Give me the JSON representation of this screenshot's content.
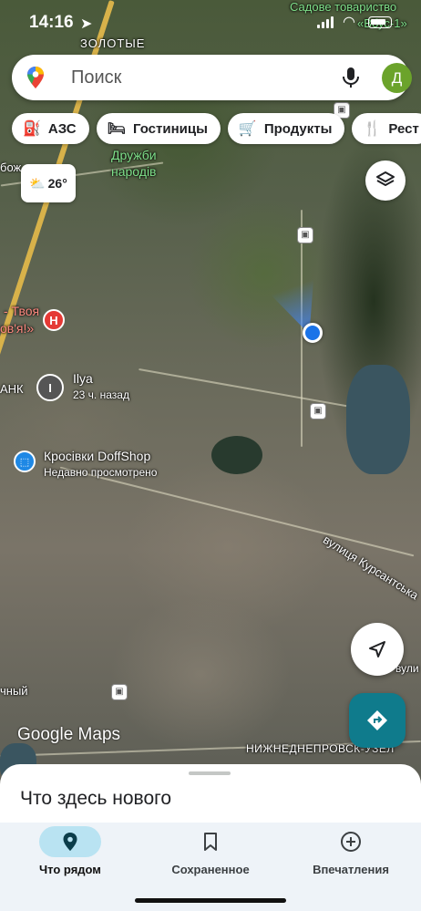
{
  "status_bar": {
    "time": "14:16",
    "carrier_label": "Садове товариство",
    "carrier_label_2": "«Вбус-1»"
  },
  "map_labels": {
    "zolotye": "ЗОЛОТЫЕ",
    "druzhby_1": "Дружби",
    "druzhby_2": "народів",
    "bozh": "бож",
    "tvoya_1": "- Твоя",
    "tvoya_2": "ов'я!»",
    "bank": "АНК",
    "ilya": "Ilya",
    "ilya_time": "23 ч. назад",
    "doffshop": "Кросівки DoffShop",
    "doffshop_sub": "Недавно просмотрено",
    "kursantska": "вулиця Курсантська",
    "chny": "чный",
    "nizhne": "НИЖНЕДНЕПРОВСК-УЗЕЛ",
    "vuli": "вули"
  },
  "search": {
    "placeholder": "Поиск",
    "avatar_letter": "Д"
  },
  "chips": [
    {
      "label": "АЗС",
      "icon": "gas-station-icon"
    },
    {
      "label": "Гостиницы",
      "icon": "bed-icon"
    },
    {
      "label": "Продукты",
      "icon": "cart-icon"
    },
    {
      "label": "Рест",
      "icon": "restaurant-icon"
    }
  ],
  "weather": {
    "temp": "26°",
    "icon": "partly-cloudy-icon"
  },
  "poi": {
    "red_letter": "H",
    "grey_letter": "I",
    "blue_icon": "shopping-bag-icon"
  },
  "google_logo": "Google Maps",
  "sheet": {
    "title": "Что здесь нового"
  },
  "bottom_nav": [
    {
      "label": "Что рядом",
      "icon": "pin-icon",
      "active": true
    },
    {
      "label": "Сохраненное",
      "icon": "bookmark-icon",
      "active": false
    },
    {
      "label": "Впечатления",
      "icon": "plus-circle-icon",
      "active": false
    }
  ],
  "colors": {
    "accent": "#1a73e8",
    "directions": "#0f7b8c",
    "avatar": "#6ba32b",
    "active_tab": "#b9e3f2"
  }
}
